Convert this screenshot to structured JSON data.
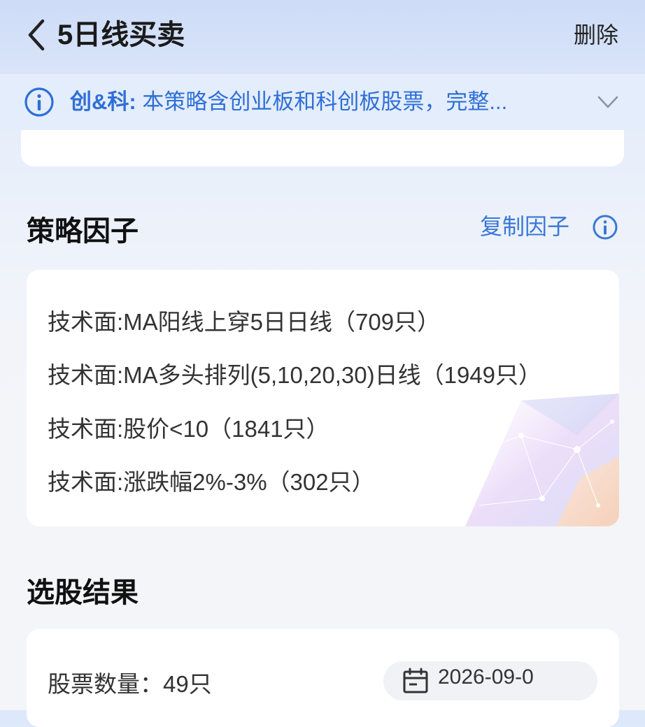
{
  "header": {
    "title": "5日线买卖",
    "delete_label": "删除"
  },
  "notice": {
    "tag": "创&科:",
    "text": "本策略含创业板和科创板股票，完整..."
  },
  "factors_section": {
    "title": "策略因子",
    "copy_label": "复制因子",
    "items": [
      "技术面:MA阳线上穿5日日线（709只）",
      "技术面:MA多头排列(5,10,20,30)日线（1949只）",
      "技术面:股价<10（1841只）",
      "技术面:涨跌幅2%-3%（302只）"
    ]
  },
  "results_section": {
    "title": "选股结果",
    "stock_count": "股票数量：49只",
    "date": "2026-09-0"
  },
  "colors": {
    "accent": "#3a78d6",
    "notice_text": "#2f6fd6",
    "notice_bg": "#e4edfc"
  }
}
